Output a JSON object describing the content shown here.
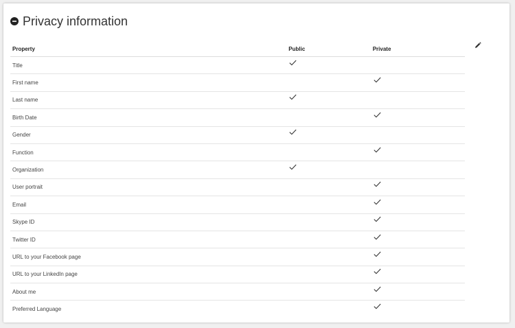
{
  "header": {
    "title": "Privacy information"
  },
  "table": {
    "columns": {
      "property": "Property",
      "public": "Public",
      "private": "Private"
    },
    "rows": [
      {
        "property": "Title",
        "visibility": "public"
      },
      {
        "property": "First name",
        "visibility": "private"
      },
      {
        "property": "Last name",
        "visibility": "public"
      },
      {
        "property": "Birth Date",
        "visibility": "private"
      },
      {
        "property": "Gender",
        "visibility": "public"
      },
      {
        "property": "Function",
        "visibility": "private"
      },
      {
        "property": "Organization",
        "visibility": "public"
      },
      {
        "property": "User portrait",
        "visibility": "private"
      },
      {
        "property": "Email",
        "visibility": "private"
      },
      {
        "property": "Skype ID",
        "visibility": "private"
      },
      {
        "property": "Twitter ID",
        "visibility": "private"
      },
      {
        "property": "URL to your Facebook page",
        "visibility": "private"
      },
      {
        "property": "URL to your LinkedIn page",
        "visibility": "private"
      },
      {
        "property": "About me",
        "visibility": "private"
      },
      {
        "property": "Preferred Language",
        "visibility": "private"
      }
    ]
  },
  "icons": {
    "collapse": "minus-circle-icon",
    "edit": "pencil-icon",
    "check": "checkmark-icon"
  },
  "colors": {
    "text": "#333333",
    "border": "#e4e4e4",
    "background": "#f0f0f0",
    "card": "#ffffff"
  }
}
